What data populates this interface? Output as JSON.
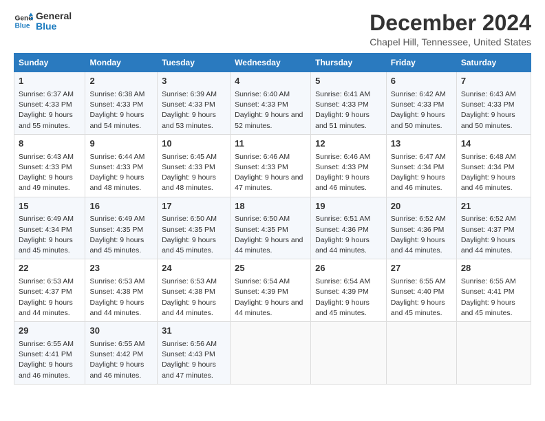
{
  "logo": {
    "line1": "General",
    "line2": "Blue"
  },
  "title": "December 2024",
  "subtitle": "Chapel Hill, Tennessee, United States",
  "headers": [
    "Sunday",
    "Monday",
    "Tuesday",
    "Wednesday",
    "Thursday",
    "Friday",
    "Saturday"
  ],
  "weeks": [
    [
      {
        "day": "1",
        "sunrise": "6:37 AM",
        "sunset": "4:33 PM",
        "daylight": "9 hours and 55 minutes."
      },
      {
        "day": "2",
        "sunrise": "6:38 AM",
        "sunset": "4:33 PM",
        "daylight": "9 hours and 54 minutes."
      },
      {
        "day": "3",
        "sunrise": "6:39 AM",
        "sunset": "4:33 PM",
        "daylight": "9 hours and 53 minutes."
      },
      {
        "day": "4",
        "sunrise": "6:40 AM",
        "sunset": "4:33 PM",
        "daylight": "9 hours and 52 minutes."
      },
      {
        "day": "5",
        "sunrise": "6:41 AM",
        "sunset": "4:33 PM",
        "daylight": "9 hours and 51 minutes."
      },
      {
        "day": "6",
        "sunrise": "6:42 AM",
        "sunset": "4:33 PM",
        "daylight": "9 hours and 50 minutes."
      },
      {
        "day": "7",
        "sunrise": "6:43 AM",
        "sunset": "4:33 PM",
        "daylight": "9 hours and 50 minutes."
      }
    ],
    [
      {
        "day": "8",
        "sunrise": "6:43 AM",
        "sunset": "4:33 PM",
        "daylight": "9 hours and 49 minutes."
      },
      {
        "day": "9",
        "sunrise": "6:44 AM",
        "sunset": "4:33 PM",
        "daylight": "9 hours and 48 minutes."
      },
      {
        "day": "10",
        "sunrise": "6:45 AM",
        "sunset": "4:33 PM",
        "daylight": "9 hours and 48 minutes."
      },
      {
        "day": "11",
        "sunrise": "6:46 AM",
        "sunset": "4:33 PM",
        "daylight": "9 hours and 47 minutes."
      },
      {
        "day": "12",
        "sunrise": "6:46 AM",
        "sunset": "4:33 PM",
        "daylight": "9 hours and 46 minutes."
      },
      {
        "day": "13",
        "sunrise": "6:47 AM",
        "sunset": "4:34 PM",
        "daylight": "9 hours and 46 minutes."
      },
      {
        "day": "14",
        "sunrise": "6:48 AM",
        "sunset": "4:34 PM",
        "daylight": "9 hours and 46 minutes."
      }
    ],
    [
      {
        "day": "15",
        "sunrise": "6:49 AM",
        "sunset": "4:34 PM",
        "daylight": "9 hours and 45 minutes."
      },
      {
        "day": "16",
        "sunrise": "6:49 AM",
        "sunset": "4:35 PM",
        "daylight": "9 hours and 45 minutes."
      },
      {
        "day": "17",
        "sunrise": "6:50 AM",
        "sunset": "4:35 PM",
        "daylight": "9 hours and 45 minutes."
      },
      {
        "day": "18",
        "sunrise": "6:50 AM",
        "sunset": "4:35 PM",
        "daylight": "9 hours and 44 minutes."
      },
      {
        "day": "19",
        "sunrise": "6:51 AM",
        "sunset": "4:36 PM",
        "daylight": "9 hours and 44 minutes."
      },
      {
        "day": "20",
        "sunrise": "6:52 AM",
        "sunset": "4:36 PM",
        "daylight": "9 hours and 44 minutes."
      },
      {
        "day": "21",
        "sunrise": "6:52 AM",
        "sunset": "4:37 PM",
        "daylight": "9 hours and 44 minutes."
      }
    ],
    [
      {
        "day": "22",
        "sunrise": "6:53 AM",
        "sunset": "4:37 PM",
        "daylight": "9 hours and 44 minutes."
      },
      {
        "day": "23",
        "sunrise": "6:53 AM",
        "sunset": "4:38 PM",
        "daylight": "9 hours and 44 minutes."
      },
      {
        "day": "24",
        "sunrise": "6:53 AM",
        "sunset": "4:38 PM",
        "daylight": "9 hours and 44 minutes."
      },
      {
        "day": "25",
        "sunrise": "6:54 AM",
        "sunset": "4:39 PM",
        "daylight": "9 hours and 44 minutes."
      },
      {
        "day": "26",
        "sunrise": "6:54 AM",
        "sunset": "4:39 PM",
        "daylight": "9 hours and 45 minutes."
      },
      {
        "day": "27",
        "sunrise": "6:55 AM",
        "sunset": "4:40 PM",
        "daylight": "9 hours and 45 minutes."
      },
      {
        "day": "28",
        "sunrise": "6:55 AM",
        "sunset": "4:41 PM",
        "daylight": "9 hours and 45 minutes."
      }
    ],
    [
      {
        "day": "29",
        "sunrise": "6:55 AM",
        "sunset": "4:41 PM",
        "daylight": "9 hours and 46 minutes."
      },
      {
        "day": "30",
        "sunrise": "6:55 AM",
        "sunset": "4:42 PM",
        "daylight": "9 hours and 46 minutes."
      },
      {
        "day": "31",
        "sunrise": "6:56 AM",
        "sunset": "4:43 PM",
        "daylight": "9 hours and 47 minutes."
      },
      null,
      null,
      null,
      null
    ]
  ],
  "labels": {
    "sunrise": "Sunrise:",
    "sunset": "Sunset:",
    "daylight": "Daylight:"
  }
}
